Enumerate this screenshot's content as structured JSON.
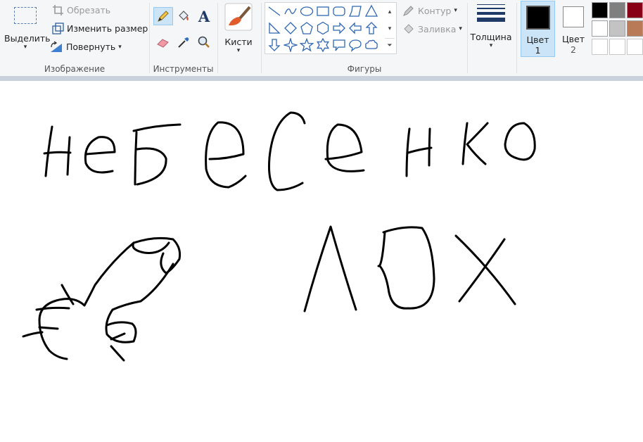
{
  "image_group": {
    "select_label": "Выделить",
    "crop_label": "Обрезать",
    "resize_label": "Изменить размер",
    "rotate_label": "Повернуть",
    "group_label": "Изображение"
  },
  "tools_group": {
    "group_label": "Инструменты",
    "text_tool_glyph": "A"
  },
  "brushes": {
    "label": "Кисти"
  },
  "shapes_group": {
    "group_label": "Фигуры",
    "outline_label": "Контур",
    "fill_label": "Заливка"
  },
  "size": {
    "label": "Толщина"
  },
  "color1": {
    "label_top": "Цвет",
    "label_bottom": "1",
    "color": "#000000"
  },
  "color2": {
    "label_top": "Цвет",
    "label_bottom": "2",
    "color": "#ffffff"
  },
  "palette": {
    "colors": [
      "#000000",
      "#7f7f7f",
      "#880015",
      "#ffffff",
      "#c3c3c3",
      "#b97a57",
      "#ffffff",
      "#ffffff",
      "#ffffff"
    ]
  },
  "accent": "#0078d7",
  "canvas": {
    "stroke_color": "#000000",
    "background": "#ffffff"
  }
}
